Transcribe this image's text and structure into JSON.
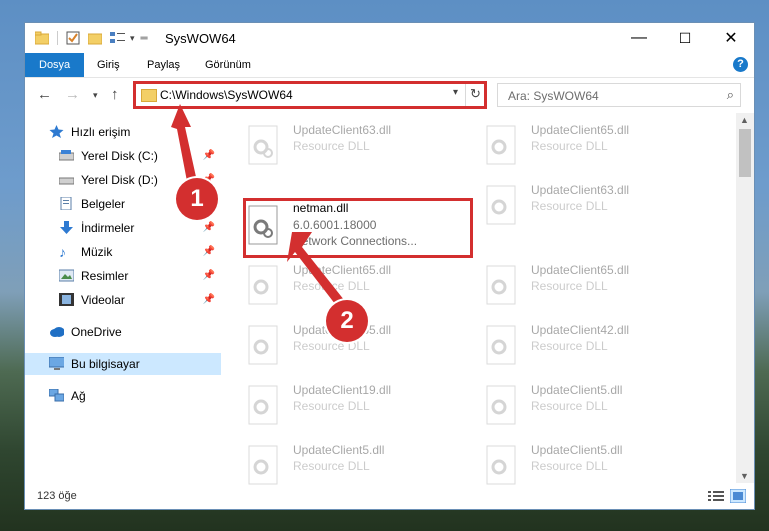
{
  "window": {
    "title": "SysWOW64",
    "minimize": "—",
    "maximize": "☐",
    "close": "✕"
  },
  "ribbon": {
    "tabs": [
      "Dosya",
      "Giriş",
      "Paylaş",
      "Görünüm"
    ],
    "help": "?"
  },
  "address": {
    "path": "C:\\Windows\\SysWOW64",
    "search_placeholder": "Ara: SysWOW64"
  },
  "sidebar": {
    "items": [
      {
        "label": "Hızlı erişim"
      },
      {
        "label": "Yerel Disk (C:)"
      },
      {
        "label": "Yerel Disk (D:)"
      },
      {
        "label": "Belgeler"
      },
      {
        "label": "İndirmeler"
      },
      {
        "label": "Müzik"
      },
      {
        "label": "Resimler"
      },
      {
        "label": "Videolar"
      },
      {
        "label": "OneDrive"
      },
      {
        "label": "Bu bilgisayar"
      },
      {
        "label": "Ağ"
      }
    ]
  },
  "files": {
    "left": [
      {
        "name": "UpdateClient63.dll",
        "desc": "Resource DLL"
      },
      {
        "name": "netman.dll",
        "version": "6.0.6001.18000",
        "desc": "Network Connections..."
      },
      {
        "name": "UpdateClient65.dll",
        "desc": "Resource DLL"
      },
      {
        "name": "UpdateClient65.dll",
        "desc": "Resource DLL"
      },
      {
        "name": "UpdateClient19.dll",
        "desc": "Resource DLL"
      },
      {
        "name": "UpdateClient5.dll",
        "desc": "Resource DLL"
      }
    ],
    "right": [
      {
        "name": "UpdateClient65.dll",
        "desc": "Resource DLL"
      },
      {
        "name": "UpdateClient63.dll",
        "desc": "Resource DLL"
      },
      {
        "name": "UpdateClient65.dll",
        "desc": "Resource DLL"
      },
      {
        "name": "UpdateClient42.dll",
        "desc": "Resource DLL"
      },
      {
        "name": "UpdateClient5.dll",
        "desc": "Resource DLL"
      },
      {
        "name": "UpdateClient5.dll",
        "desc": "Resource DLL"
      }
    ]
  },
  "status": {
    "count": "123 öğe"
  },
  "annotations": {
    "step1": "1",
    "step2": "2",
    "color": "#d32f2f"
  }
}
